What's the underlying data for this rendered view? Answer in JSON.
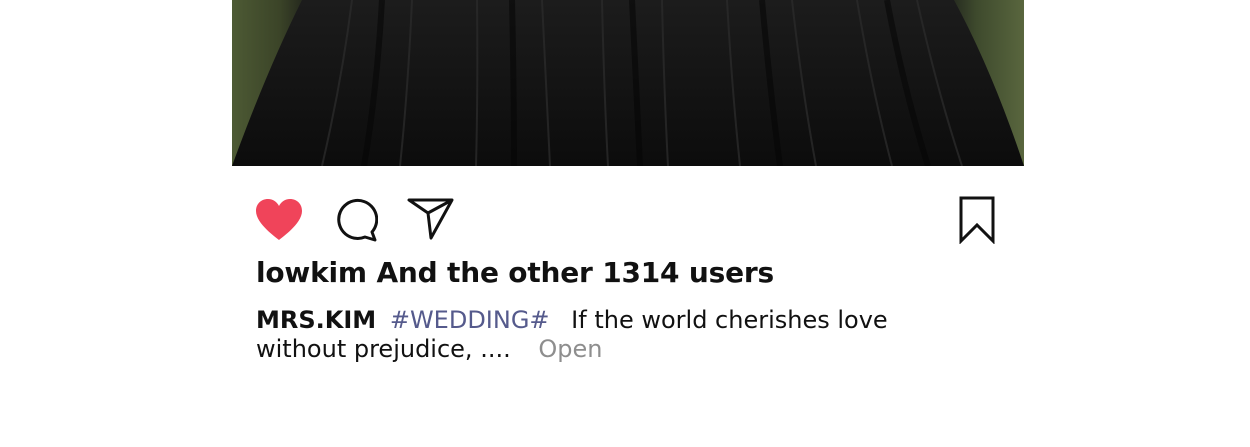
{
  "post": {
    "photo_alt": "Black tulle dress",
    "liked": true,
    "colors": {
      "heart": "#f0445a",
      "text": "#111111",
      "hashtag": "#555a8c",
      "more": "#8e8e8e"
    },
    "icons": [
      "heart-icon",
      "comment-icon",
      "send-icon",
      "bookmark-icon"
    ],
    "likes_text": "lowkim And the other 1314 users",
    "caption": {
      "author": "MRS.KIM",
      "hashtag": "#WEDDING#",
      "text": "If the world cherishes love without prejudice, ....",
      "more_label": "Open"
    }
  }
}
